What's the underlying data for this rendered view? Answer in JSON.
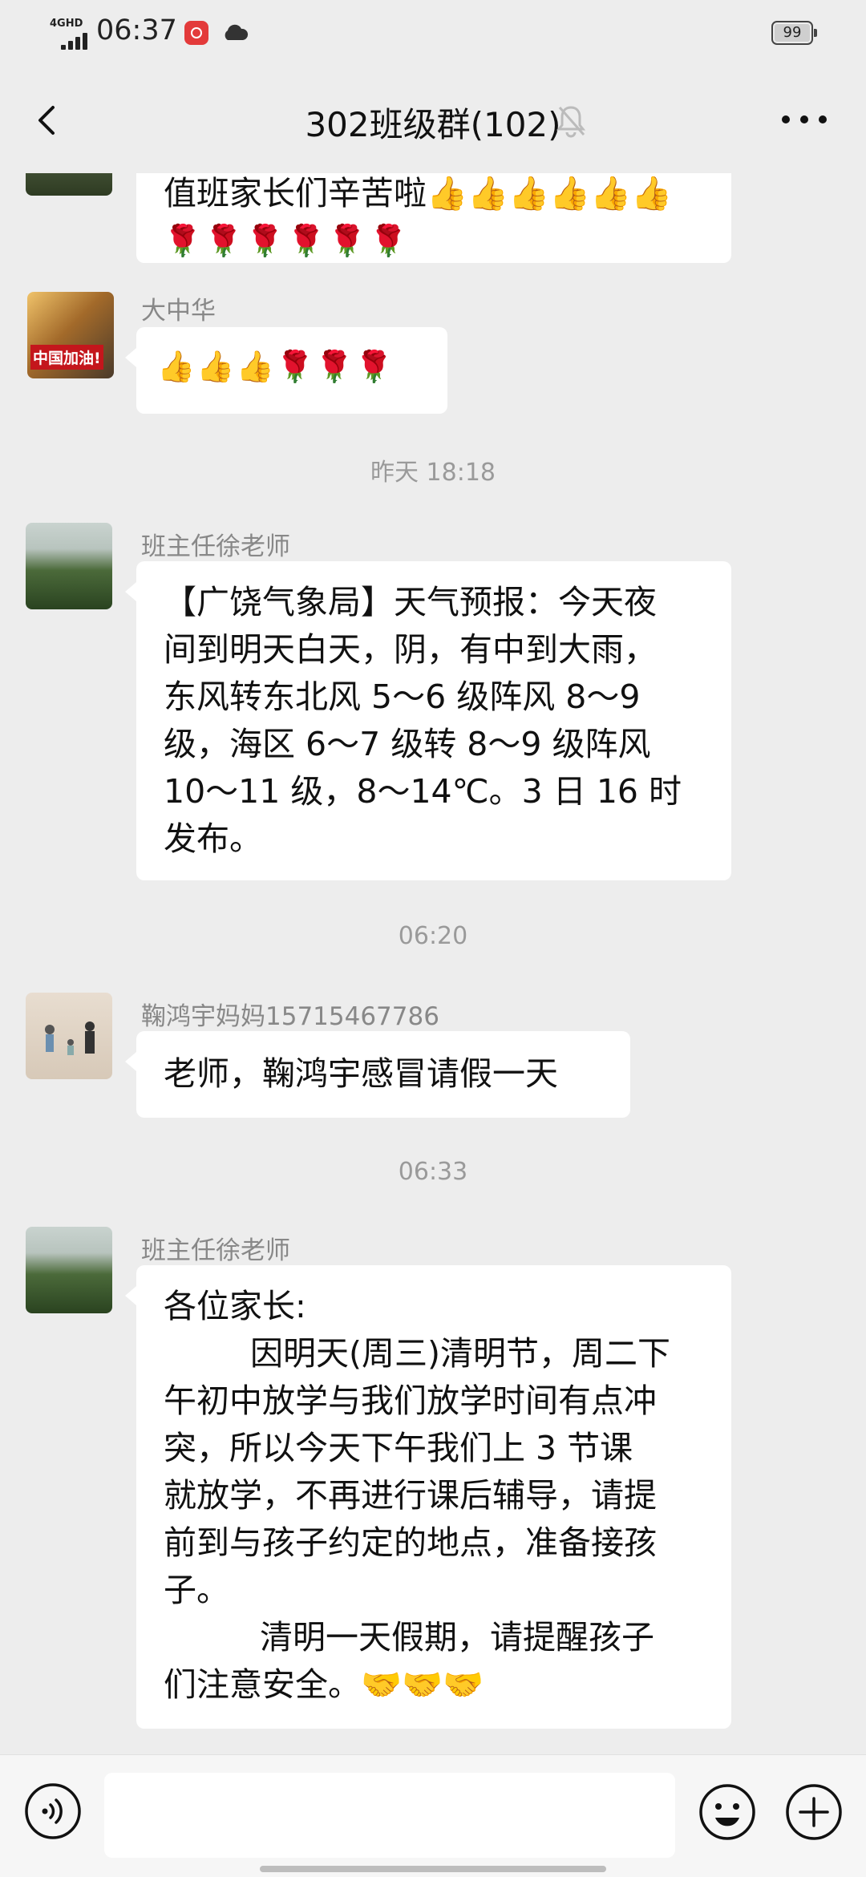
{
  "status_bar": {
    "network": "4GHD",
    "time": "06:37",
    "battery": "99"
  },
  "header": {
    "title": "302班级群(102)",
    "back_icon": "chevron-left-icon",
    "muted_icon": "bell-off-icon",
    "more_icon": "more-dots-icon"
  },
  "messages": {
    "m0": {
      "line1": "值班家长们辛苦啦👍👍👍👍👍👍",
      "line2": "🌹🌹🌹🌹🌹🌹"
    },
    "m1": {
      "sender": "大中华",
      "avatar_text": "中国加油!",
      "text": "👍👍👍🌹🌹🌹"
    },
    "t1": "昨天 18:18",
    "m2": {
      "sender": "班主任徐老师",
      "lines": [
        "【广饶气象局】天气预报：今天夜",
        "间到明天白天，阴，有中到大雨，",
        "东风转东北风 5～6 级阵风 8～9",
        "级，海区 6～7 级转 8～9 级阵风",
        "10～11 级，8～14℃。3 日 16 时",
        "发布。"
      ]
    },
    "t2": "06:20",
    "m3": {
      "sender": "鞠鸿宇妈妈15715467786",
      "text": "老师，鞠鸿宇感冒请假一天"
    },
    "t3": "06:33",
    "m4": {
      "sender": "班主任徐老师",
      "lines": [
        "各位家长:",
        "因明天(周三)清明节，周二下",
        "午初中放学与我们放学时间有点冲",
        "突，所以今天下午我们上 3 节课",
        "就放学，不再进行课后辅导，请提",
        "前到与孩子约定的地点，准备接孩",
        "子。",
        "清明一天假期，请提醒孩子",
        "们注意安全。🤝🤝🤝"
      ]
    }
  },
  "input_bar": {
    "voice_icon": "voice-icon",
    "emoji_icon": "emoji-icon",
    "plus_icon": "plus-circle-icon",
    "input_value": ""
  },
  "colors": {
    "background": "#ededed",
    "bubble": "#ffffff",
    "meta_text": "#888888"
  }
}
